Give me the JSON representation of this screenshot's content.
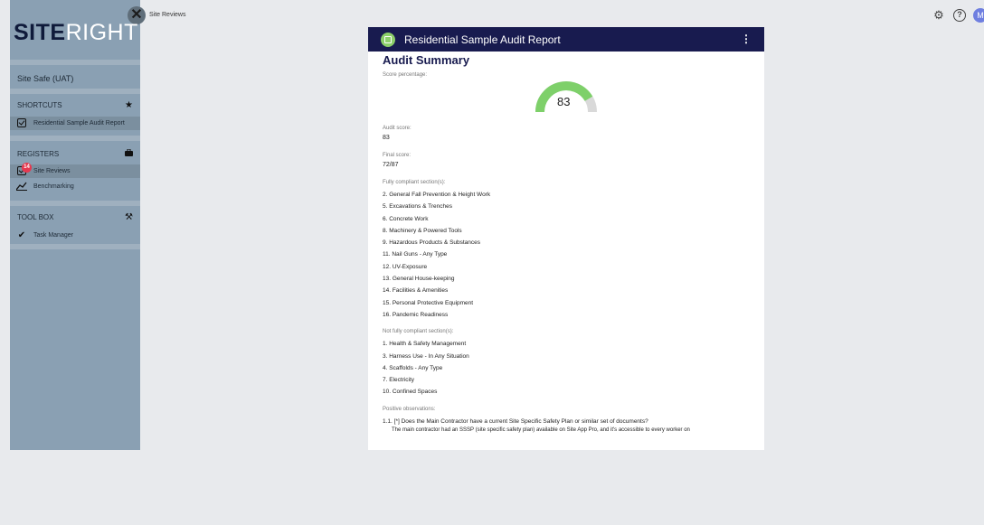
{
  "sidebar": {
    "close_icon_glyph": "✕",
    "logo_bold": "SITE",
    "logo_regular": "RIGHT",
    "org": "Site Safe (UAT)",
    "shortcuts": {
      "heading": "SHORTCUTS",
      "icon": "star-icon",
      "items": [
        {
          "label": "Residential Sample Audit Report"
        }
      ]
    },
    "registers": {
      "heading": "REGISTERS",
      "icon": "briefcase-icon",
      "items": [
        {
          "label": "Site Reviews",
          "badge": "14",
          "active": true
        },
        {
          "label": "Benchmarking"
        }
      ]
    },
    "toolbox": {
      "heading": "TOOL BOX",
      "icon": "tools-icon",
      "items": [
        {
          "label": "Task Manager"
        }
      ]
    }
  },
  "breadcrumb": "Site Reviews",
  "topbar": {
    "settings_icon": "gear-icon",
    "help_icon": "help-icon",
    "help_glyph": "?",
    "avatar_initial": "M"
  },
  "report": {
    "title": "Residential Sample Audit Report",
    "menu_glyph": "⋮",
    "heading": "Audit Summary",
    "score_percentage_label": "Score percentage:",
    "score_percentage": 83,
    "audit_score_label": "Audit score:",
    "audit_score": "83",
    "final_score_label": "Final score:",
    "final_score": "72/87",
    "compliant_label": "Fully compliant section(s):",
    "compliant": [
      "2. General Fall Prevention & Height Work",
      "5. Excavations & Trenches",
      "6. Concrete Work",
      "8. Machinery & Powered Tools",
      "9. Hazardous Products & Substances",
      "11. Nail Guns - Any Type",
      "12. UV-Exposure",
      "13. General House-keeping",
      "14. Facilities & Amenities",
      "15. Personal Protective Equipment",
      "16. Pandemic Readiness"
    ],
    "not_compliant_label": "Not fully compliant section(s):",
    "not_compliant": [
      "1. Health & Safety Management",
      "3. Harness Use - In Any Situation",
      "4. Scaffolds - Any Type",
      "7. Electricity",
      "10. Confined Spaces"
    ],
    "positive_label": "Positive observations:",
    "positive_first": "1.1. [*] Does the Main Contractor have a current Site Specific Safety Plan or similar set of documents?",
    "positive_answer": "The main contractor had an SSSP (site specific safety plan) available on Site App Pro, and it's accessible to every worker on"
  },
  "colors": {
    "sidebar_bg": "#8aa0b3",
    "header_bg": "#181b4f",
    "gauge_fill": "#7ed06a",
    "gauge_track": "#d9d9d9",
    "badge": "#e53950"
  }
}
